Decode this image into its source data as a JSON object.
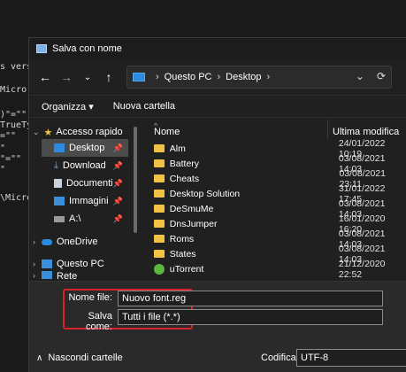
{
  "editor_lines": [
    "s vers",
    "Micro",
    ")\"=\"\"",
    "TrueTy",
    "=\"\"",
    "\"",
    "\"=\"\"",
    "\"",
    "\\Micro"
  ],
  "dialog": {
    "title": "Salva con nome"
  },
  "address": {
    "root": "Questo PC",
    "folder": "Desktop"
  },
  "toolbar": {
    "organize": "Organizza",
    "new_folder": "Nuova cartella"
  },
  "sidebar": [
    {
      "label": "Accesso rapido",
      "icon": "star-icon"
    },
    {
      "label": "Desktop",
      "icon": "desktop-icon"
    },
    {
      "label": "Download",
      "icon": "download-icon"
    },
    {
      "label": "Documenti",
      "icon": "document-icon"
    },
    {
      "label": "Immagini",
      "icon": "image-icon"
    },
    {
      "label": "A:\\",
      "icon": "drive-icon"
    },
    {
      "label": "OneDrive",
      "icon": "cloud-icon"
    },
    {
      "label": "Questo PC",
      "icon": "pc-icon"
    },
    {
      "label": "Rete",
      "icon": "network-icon"
    }
  ],
  "filelist": {
    "columns": {
      "name": "Nome",
      "modified": "Ultima modifica"
    },
    "rows": [
      {
        "name": "Alm",
        "date": "24/01/2022 10:19",
        "icon": "folder-icon"
      },
      {
        "name": "Battery",
        "date": "03/08/2021 14:03",
        "icon": "folder-icon"
      },
      {
        "name": "Cheats",
        "date": "03/08/2021 23:11",
        "icon": "folder-icon"
      },
      {
        "name": "Desktop Solution",
        "date": "31/01/2022 17:45",
        "icon": "folder-icon"
      },
      {
        "name": "DeSmuMe",
        "date": "03/08/2021 14:03",
        "icon": "folder-icon"
      },
      {
        "name": "DnsJumper",
        "date": "16/01/2020 16:20",
        "icon": "folder-icon"
      },
      {
        "name": "Roms",
        "date": "03/08/2021 14:03",
        "icon": "folder-icon"
      },
      {
        "name": "States",
        "date": "03/08/2021 14:03",
        "icon": "folder-icon"
      },
      {
        "name": "uTorrent",
        "date": "21/12/2020 22:52",
        "icon": "app-icon"
      }
    ]
  },
  "footer": {
    "filename_label": "Nome file:",
    "filename_value": "Nuovo font.reg",
    "savetype_label": "Salva come:",
    "savetype_value": "Tutti i file  (*.*)",
    "hide_folders": "Nascondi cartelle",
    "encoding_label": "Codifica:",
    "encoding_value": "UTF-8"
  },
  "colors": {
    "highlight": "#d8222a",
    "folder": "#f2c244",
    "selection": "#4b4b4b"
  }
}
